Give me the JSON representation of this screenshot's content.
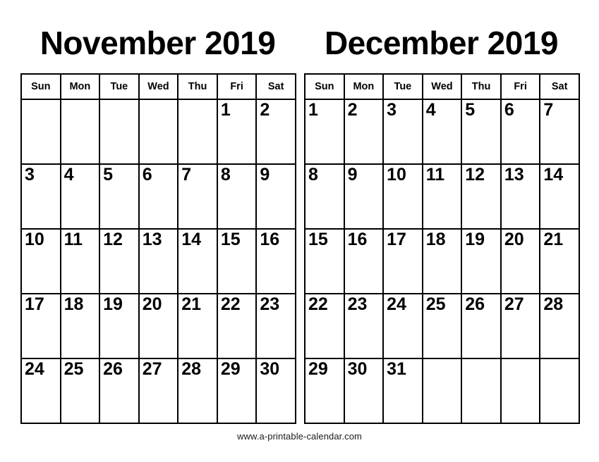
{
  "document": {
    "type": "printable-calendar",
    "footer_text": "www.a-printable-calendar.com"
  },
  "weekdays": [
    "Sun",
    "Mon",
    "Tue",
    "Wed",
    "Thu",
    "Fri",
    "Sat"
  ],
  "months": [
    {
      "title": "November 2019",
      "name": "November",
      "year": "2019",
      "weeks": [
        [
          "",
          "",
          "",
          "",
          "",
          "1",
          "2"
        ],
        [
          "3",
          "4",
          "5",
          "6",
          "7",
          "8",
          "9"
        ],
        [
          "10",
          "11",
          "12",
          "13",
          "14",
          "15",
          "16"
        ],
        [
          "17",
          "18",
          "19",
          "20",
          "21",
          "22",
          "23"
        ],
        [
          "24",
          "25",
          "26",
          "27",
          "28",
          "29",
          "30"
        ]
      ]
    },
    {
      "title": "December 2019",
      "name": "December",
      "year": "2019",
      "weeks": [
        [
          "1",
          "2",
          "3",
          "4",
          "5",
          "6",
          "7"
        ],
        [
          "8",
          "9",
          "10",
          "11",
          "12",
          "13",
          "14"
        ],
        [
          "15",
          "16",
          "17",
          "18",
          "19",
          "20",
          "21"
        ],
        [
          "22",
          "23",
          "24",
          "25",
          "26",
          "27",
          "28"
        ],
        [
          "29",
          "30",
          "31",
          "",
          "",
          "",
          ""
        ]
      ]
    }
  ]
}
